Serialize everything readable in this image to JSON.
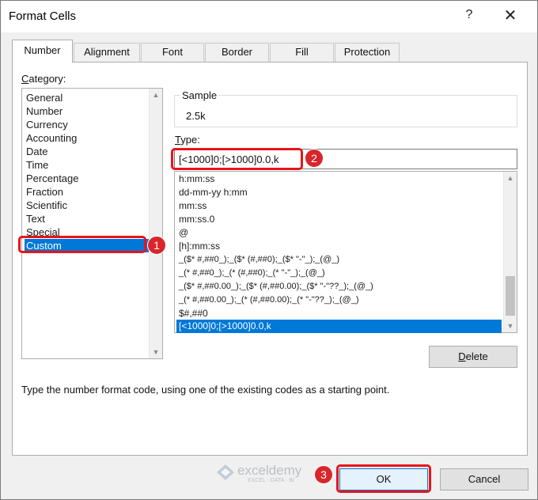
{
  "window": {
    "title": "Format Cells",
    "help_label": "?",
    "close_label": "✕"
  },
  "tabs": [
    "Number",
    "Alignment",
    "Font",
    "Border",
    "Fill",
    "Protection"
  ],
  "category": {
    "label": "Category:",
    "items": [
      "General",
      "Number",
      "Currency",
      "Accounting",
      "Date",
      "Time",
      "Percentage",
      "Fraction",
      "Scientific",
      "Text",
      "Special",
      "Custom"
    ],
    "selected": "Custom"
  },
  "sample": {
    "label": "Sample",
    "value": "2.5k"
  },
  "type": {
    "label": "Type:",
    "value": "[<1000]0;[>1000]0.0,k"
  },
  "format_list": {
    "items": [
      "h:mm:ss",
      "dd-mm-yy h:mm",
      "mm:ss",
      "mm:ss.0",
      "@",
      "[h]:mm:ss",
      "_($* #,##0_);_($* (#,##0);_($* \"-\"_);_(@_)",
      "_(* #,##0_);_(* (#,##0);_(* \"-\"_);_(@_)",
      "_($* #,##0.00_);_($* (#,##0.00);_($* \"-\"??_);_(@_)",
      "_(* #,##0.00_);_(* (#,##0.00);_(* \"-\"??_);_(@_)",
      "$#,##0",
      "[<1000]0;[>1000]0.0,k"
    ],
    "selected": "[<1000]0;[>1000]0.0,k"
  },
  "delete_button": "Delete",
  "hint": "Type the number format code, using one of the existing codes as a starting point.",
  "buttons": {
    "ok": "OK",
    "cancel": "Cancel"
  },
  "annotations": [
    "1",
    "2",
    "3"
  ],
  "watermark": {
    "brand": "exceldemy",
    "tagline": "EXCEL · DATA · BI"
  },
  "colors": {
    "accent": "#0078d7",
    "annotation_red": "#e8141b"
  }
}
